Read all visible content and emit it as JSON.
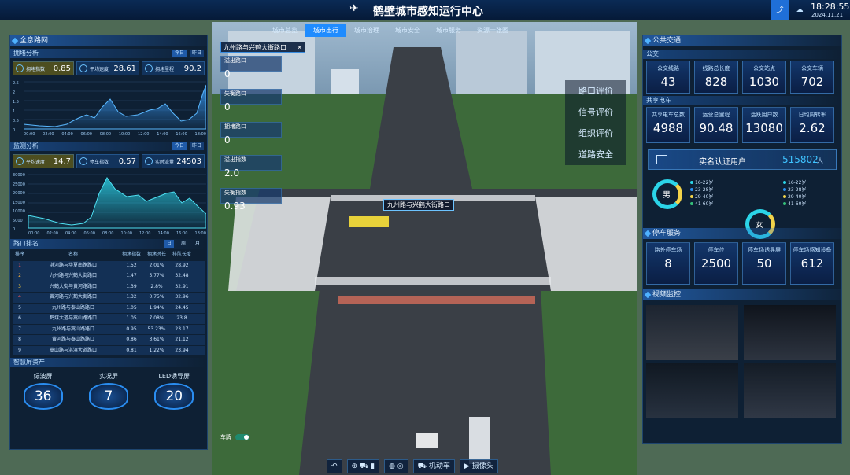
{
  "title": "鹤壁城市感知运行中心",
  "clock": {
    "time": "18:28:55",
    "date": "2024.11.21"
  },
  "nav": [
    "城市总览",
    "城市出行",
    "城市治理",
    "城市安全",
    "城市服务",
    "资源一张图"
  ],
  "nav_active": 1,
  "left": {
    "overview_title": "全息路网",
    "congestion": {
      "title": "拥堵分析",
      "btn1": "今日",
      "btn2": "昨日",
      "stats": [
        {
          "label": "拥堵指数",
          "value": "0.85"
        },
        {
          "label": "平均速度",
          "value": "28.61"
        },
        {
          "label": "拥堵里程",
          "value": "90.2"
        }
      ],
      "y_ticks": [
        "2.5",
        "2",
        "1.5",
        "1",
        "0.5",
        "0"
      ],
      "x_ticks": [
        "00:00",
        "02:00",
        "04:00",
        "06:00",
        "08:00",
        "10:00",
        "12:00",
        "14:00",
        "16:00",
        "18:00"
      ]
    },
    "monitor": {
      "title": "监测分析",
      "btn1": "今日",
      "btn2": "昨日",
      "stats": [
        {
          "label": "平均速度",
          "value": "14.7"
        },
        {
          "label": "停车指数",
          "value": "0.57"
        },
        {
          "label": "实时流量",
          "value": "24503"
        }
      ],
      "y_ticks": [
        "30000",
        "25000",
        "20000",
        "15000",
        "10000",
        "5000",
        "0"
      ],
      "x_ticks": [
        "00:00",
        "02:00",
        "04:00",
        "06:00",
        "08:00",
        "10:00",
        "12:00",
        "14:00",
        "16:00",
        "18:00"
      ]
    },
    "ranking": {
      "title": "路口排名",
      "tabs": [
        "日",
        "周",
        "月"
      ],
      "headers": [
        "排序",
        "名称",
        "拥堵指数",
        "拥堵时长",
        "排队长度"
      ],
      "rows": [
        [
          "1",
          "淇河路与华夏南路路口",
          "1.52",
          "2.01%",
          "28.92"
        ],
        [
          "2",
          "九州路与兴鹤大街路口",
          "1.47",
          "5.77%",
          "32.48"
        ],
        [
          "3",
          "兴鹤大街与黄河路路口",
          "1.39",
          "2.8%",
          "32.91"
        ],
        [
          "4",
          "黄河路与兴鹤大街路口",
          "1.32",
          "0.75%",
          "32.96"
        ],
        [
          "5",
          "九州路与泰山路路口",
          "1.05",
          "1.94%",
          "24.45"
        ],
        [
          "6",
          "鹤煤大道与嵩山路路口",
          "1.05",
          "7.08%",
          "23.8"
        ],
        [
          "7",
          "九州路与嵩山路路口",
          "0.95",
          "53.23%",
          "23.17"
        ],
        [
          "8",
          "黄河路与泰山路路口",
          "0.86",
          "3.61%",
          "21.12"
        ],
        [
          "9",
          "嵩山路与淇滨大道路口",
          "0.81",
          "1.22%",
          "23.94"
        ]
      ]
    },
    "screens": {
      "title": "智慧屏资产",
      "items": [
        {
          "label": "绿波屏",
          "value": "36"
        },
        {
          "label": "实况屏",
          "value": "7"
        },
        {
          "label": "LED诱导屏",
          "value": "20"
        }
      ]
    }
  },
  "intersection": {
    "name": "九州路与兴鹤大街路口",
    "metrics": [
      {
        "label": "溢出路口",
        "value": "0"
      },
      {
        "label": "失衡路口",
        "value": "0"
      },
      {
        "label": "拥堵路口",
        "value": "0"
      },
      {
        "label": "溢出指数",
        "value": "2.0"
      },
      {
        "label": "失衡指数",
        "value": "0.93"
      }
    ],
    "map_label": "九州路与兴鹤大街路口",
    "evals": [
      "路口评价",
      "信号评价",
      "组织评价",
      "道路安全"
    ],
    "toggle_label": "车牌"
  },
  "right": {
    "title": "公共交通",
    "bus": {
      "title": "公交",
      "cards": [
        {
          "label": "公交线路",
          "value": "43"
        },
        {
          "label": "线路总长度",
          "value": "828"
        },
        {
          "label": "公交站点",
          "value": "1030"
        },
        {
          "label": "公交车辆",
          "value": "702"
        }
      ]
    },
    "bike": {
      "title": "共享电车",
      "cards": [
        {
          "label": "共享电车总数",
          "value": "4988"
        },
        {
          "label": "运营总里程",
          "value": "90.48"
        },
        {
          "label": "活跃用户数",
          "value": "13080"
        },
        {
          "label": "日均周转率",
          "value": "2.62"
        }
      ]
    },
    "realname": {
      "label": "实名认证用户",
      "value": "515802",
      "unit": "人"
    },
    "age_male": [
      "16-22岁",
      "23-28岁",
      "29-40岁",
      "41-60岁"
    ],
    "age_female": [
      "16-22岁",
      "23-28岁",
      "29-40岁",
      "41-60岁"
    ],
    "gender": [
      "男",
      "女"
    ],
    "parking": {
      "title": "停车服务",
      "cards": [
        {
          "label": "路外停车场",
          "value": "8"
        },
        {
          "label": "停车位",
          "value": "2500"
        },
        {
          "label": "停车场诱导屏",
          "value": "50"
        },
        {
          "label": "停车场感知设备",
          "value": "612"
        }
      ]
    },
    "video": {
      "title": "视频监控"
    }
  },
  "bottom": {
    "btn_car": "机动车",
    "btn_cam": "摄像头"
  },
  "colors": {
    "accent": "#1f8cff",
    "panel": "#061630",
    "cyan": "#2bd4e8",
    "red": "#e03b3b"
  }
}
